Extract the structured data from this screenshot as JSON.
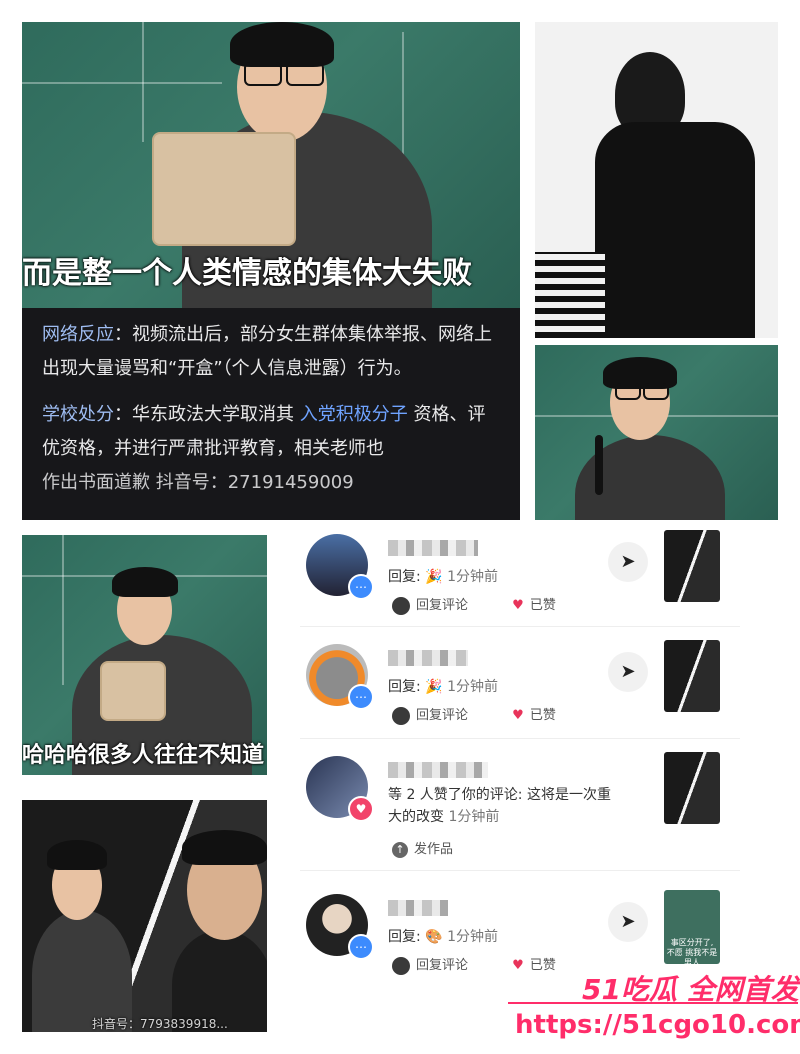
{
  "top_left_panel": {
    "caption": "而是整一个人类情感的集体大失败"
  },
  "text_panel": {
    "p1_label": "网络反应",
    "p1_text": "：视频流出后，部分女生群体集体举报、网络上出现大量谩骂和“开盒”（个人信息泄露）行为。",
    "p2_label": "学校处分",
    "p2_text_a": "：华东政法大学取消其 ",
    "p2_link": "入党积极分子",
    "p2_text_b": " 资格、评优资格，并进行严肃批评教育，相关老师也",
    "p2_partial": "作出书面道歉   抖音号：27191459009"
  },
  "mid_left_panel": {
    "caption": "哈哈哈很多人往往不知道"
  },
  "bottom_left_panel": {
    "caption": "抖音号：7793839918..."
  },
  "comments": [
    {
      "reply_prefix": "回复:",
      "time": "1分钟前",
      "reply_action": "回复评论",
      "liked_label": "已赞",
      "badge": "chat-badge"
    },
    {
      "reply_prefix": "回复:",
      "time": "1分钟前",
      "reply_action": "回复评论",
      "liked_label": "已赞",
      "badge": "chat-badge"
    },
    {
      "text_line1": "等 2 人赞了你的评论: 这将是一次重",
      "text_line2": "大的改变",
      "time": "1分钟前",
      "action": "发作品",
      "badge": "heart-badge"
    },
    {
      "reply_prefix": "回复:",
      "time": "1分钟前",
      "reply_action": "回复评论",
      "liked_label": "已赞",
      "thumb_caption": "事区分开了, 不愿 挑我不是男人",
      "badge": "chat-badge"
    }
  ],
  "watermark": {
    "line1": "51吃瓜 全网首发",
    "line2": "https://51cgo10.com",
    "color": "#ff2d6a"
  }
}
